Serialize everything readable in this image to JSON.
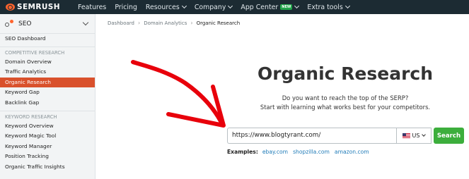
{
  "brand": {
    "name": "SEMRUSH",
    "logo_color": "#ff642d"
  },
  "topnav": {
    "items": [
      {
        "label": "Features",
        "dropdown": false
      },
      {
        "label": "Pricing",
        "dropdown": false
      },
      {
        "label": "Resources",
        "dropdown": true
      },
      {
        "label": "Company",
        "dropdown": true
      },
      {
        "label": "App Center",
        "dropdown": true,
        "badge": "NEW"
      },
      {
        "label": "Extra tools",
        "dropdown": true
      }
    ]
  },
  "sidebar": {
    "title": "SEO",
    "items": [
      {
        "label": "SEO Dashboard"
      },
      {
        "section": "COMPETITIVE RESEARCH"
      },
      {
        "label": "Domain Overview"
      },
      {
        "label": "Traffic Analytics"
      },
      {
        "label": "Organic Research",
        "active": true
      },
      {
        "label": "Keyword Gap"
      },
      {
        "label": "Backlink Gap"
      },
      {
        "section": "KEYWORD RESEARCH"
      },
      {
        "label": "Keyword Overview"
      },
      {
        "label": "Keyword Magic Tool"
      },
      {
        "label": "Keyword Manager"
      },
      {
        "label": "Position Tracking"
      },
      {
        "label": "Organic Traffic Insights"
      }
    ],
    "active_color": "#d9512c"
  },
  "breadcrumb": [
    "Dashboard",
    "Domain Analytics",
    "Organic Research"
  ],
  "main": {
    "title": "Organic Research",
    "subtitle_line1": "Do you want to reach the top of the SERP?",
    "subtitle_line2": "Start with learning what works best for your competitors.",
    "search": {
      "value": "https://www.blogtyrant.com/",
      "database": "US",
      "button": "Search",
      "button_color": "#3cae3c"
    },
    "examples": {
      "label": "Examples:",
      "links": [
        "ebay.com",
        "shopzilla.com",
        "amazon.com"
      ]
    }
  },
  "annotation": {
    "type": "red-hand-drawn-arrow",
    "color": "#e8000b"
  }
}
